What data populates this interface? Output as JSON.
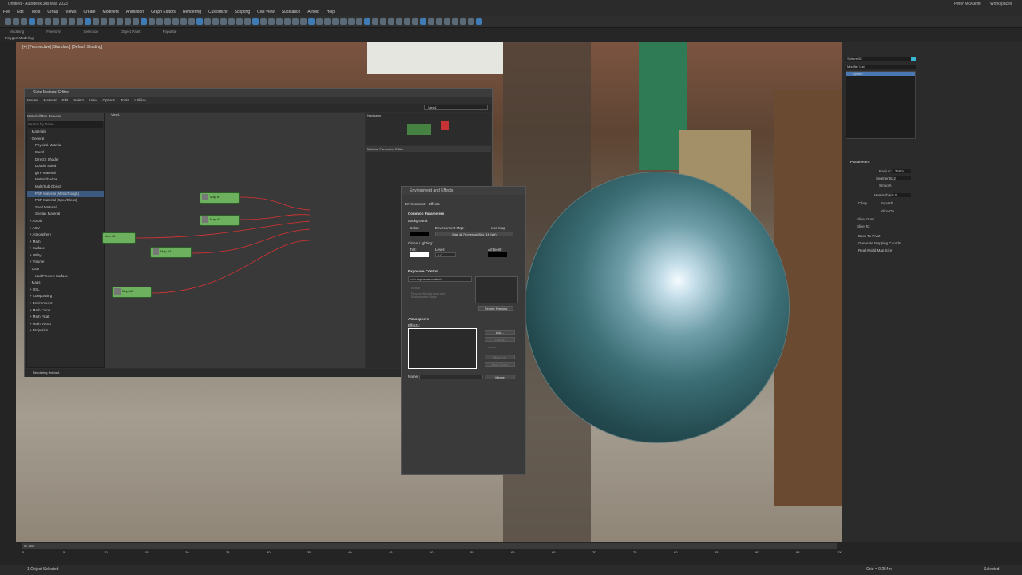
{
  "window": {
    "title": "Untitled - Autodesk 3ds Max 2023",
    "user": "Peter McAuliffe",
    "workspace": "Workspaces"
  },
  "menu": [
    "File",
    "Edit",
    "Tools",
    "Group",
    "Views",
    "Create",
    "Modifiers",
    "Animation",
    "Graph Editors",
    "Rendering",
    "Customize",
    "Scripting",
    "Civil View",
    "Substance",
    "Arnold",
    "Help"
  ],
  "ribbon": {
    "tabs": [
      "Modeling",
      "Freeform",
      "Selection",
      "Object Paint",
      "Populate"
    ],
    "sub": "Polygon Modeling"
  },
  "viewport": {
    "label": "[+] [Perspective] [Standard] [Default Shading]"
  },
  "slate": {
    "title": "Slate Material Editor",
    "menu": [
      "Modes",
      "Material",
      "Edit",
      "Select",
      "View",
      "Options",
      "Tools",
      "Utilities"
    ],
    "view_name": "View1",
    "browser_title": "Material/Map Browser",
    "search": "Search by Name ...",
    "items": [
      "- Materials",
      "- General",
      "Physical Material",
      "Blend",
      "DirectX Shader",
      "Double Sided",
      "glTF Material",
      "Matte/Shadow",
      "Multi/Sub-Object",
      "PBR Material (Metal/Rough)",
      "PBR Material (Spec/Gloss)",
      "Shell Material",
      "Shellac Material",
      "+ Arnold",
      "+ AOV",
      "+ Atmosphere",
      "+ Math",
      "+ Surface",
      "+ Utility",
      "+ Volume",
      "- USD",
      "Usd Preview Surface",
      "- Maps",
      "+ OSL",
      "+ Compositing",
      "+ Environment",
      "+ Math Color",
      "+ Math Float",
      "+ Math Vector",
      "+ Projection"
    ],
    "navigator": "Navigator",
    "param_editor": "Material Parameter Editor",
    "tab": "View1",
    "status": "Rendering finished",
    "nodes": [
      {
        "title": "Map #1",
        "sub": "Bitmap"
      },
      {
        "title": "Map #2",
        "sub": "Bitmap"
      },
      {
        "title": "Map #3",
        "sub": "Bitmap"
      },
      {
        "title": "Map #4",
        "sub": "Bitmap"
      },
      {
        "title": "Map #5",
        "sub": "Bitmap"
      }
    ],
    "material_node": {
      "title": "Material #27",
      "sub": "PBR Mate...",
      "slots": [
        "Base Color Map",
        "Roughness Map",
        "Displacement Map",
        "Ao Map",
        "Normal Map",
        "Emission Map",
        "Opacity Map",
        "Metalness Map",
        "Displacement Map"
      ]
    }
  },
  "env": {
    "title": "Environment and Effects",
    "tabs": [
      "Environment",
      "Effects"
    ],
    "common": "Common Parameters",
    "background": "Background:",
    "color": "Color:",
    "env_map": "Environment Map:",
    "use_map": "Use Map",
    "map_name": "Map #17 (overcastSky_1K.hdr)",
    "global_lighting": "Global Lighting:",
    "tint": "Tint:",
    "level": "Level:",
    "level_val": "1.0",
    "ambient": "Ambient:",
    "exposure": "Exposure Control",
    "exposure_sel": "<no exposure control>",
    "active": "Active",
    "process_bg": "Process Background and Environment Maps",
    "render_preview": "Render Preview",
    "atmosphere": "Atmosphere",
    "effects": "Effects:",
    "add": "Add...",
    "delete": "Delete",
    "active2": "Active",
    "move_up": "Move Up",
    "move_down": "Move Down",
    "name": "Name:",
    "merge": "Merge"
  },
  "right": {
    "object": "Sphere001",
    "modlist": "Modifier List",
    "stack": "Sphere",
    "params": "Parameters",
    "radius": "Radius:",
    "radius_v": "1.366m",
    "segments": "Segments:",
    "segments_v": "32",
    "smooth": "Smooth",
    "hemisphere": "Hemisphere:",
    "hemisphere_v": "0.0",
    "chop": "Chop",
    "squash": "Squash",
    "slice_on": "Slice On",
    "slice_from": "Slice From:",
    "slice_from_v": "0.0",
    "slice_to": "Slice To:",
    "slice_to_v": "0.0",
    "base_to_pivot": "Base To Pivot",
    "gen_mapping": "Generate Mapping Coords.",
    "real_world": "Real-World Map Size"
  },
  "timeline": {
    "frame": "0 / 100",
    "ticks": [
      "0",
      "5",
      "10",
      "15",
      "20",
      "25",
      "30",
      "35",
      "40",
      "45",
      "50",
      "55",
      "60",
      "65",
      "70",
      "75",
      "80",
      "85",
      "90",
      "95",
      "100"
    ]
  },
  "status": {
    "selected": "1 Object Selected",
    "grid": "Grid = 0.254m",
    "mode": "Selected"
  }
}
